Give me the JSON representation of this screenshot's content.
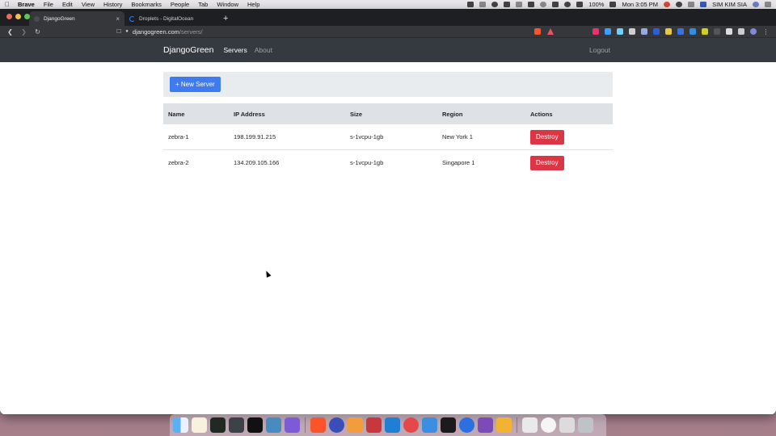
{
  "menubar": {
    "app": "Brave",
    "menus": [
      "File",
      "Edit",
      "View",
      "History",
      "Bookmarks",
      "People",
      "Tab",
      "Window",
      "Help"
    ],
    "battery": "100%",
    "clock": "Mon 3:05 PM",
    "user": "SIM KIM SIA"
  },
  "browser": {
    "tabs": [
      {
        "title": "DjangoGreen",
        "icon": "page-icon"
      },
      {
        "title": "Droplets - DigitalOcean",
        "icon": "digitalocean-icon"
      }
    ],
    "url_host": "djangogreen.com",
    "url_path": "/servers/"
  },
  "navbar": {
    "brand": "DjangoGreen",
    "links": [
      "Servers",
      "About"
    ],
    "logout": "Logout"
  },
  "toolbar": {
    "new_server_label": "+ New Server"
  },
  "table": {
    "headers": [
      "Name",
      "IP Address",
      "Size",
      "Region",
      "Actions"
    ],
    "rows": [
      {
        "name": "zebra-1",
        "ip": "198.199.91.215",
        "size": "s-1vcpu-1gb",
        "region": "New York 1",
        "action": "Destroy"
      },
      {
        "name": "zebra-2",
        "ip": "134.209.105.166",
        "size": "s-1vcpu-1gb",
        "region": "Singapore 1",
        "action": "Destroy"
      }
    ]
  },
  "colors": {
    "navbar_bg": "#343a40",
    "primary": "#3f7bf0",
    "danger": "#dc3545",
    "jumbotron_bg": "#e9ecef"
  },
  "dock": {
    "icons": [
      "finder-icon",
      "notes-icon",
      "activity-monitor-icon",
      "layers-icon",
      "apple-tv-icon",
      "godot-icon",
      "obsidian-icon",
      "brave-icon",
      "github-desktop-icon",
      "sublime-icon",
      "zotero-icon",
      "vscode-icon",
      "pocketcasts-icon",
      "simulator-icon",
      "terminal-icon",
      "onepassword-icon",
      "mongodb-compass-icon",
      "pouch-icon",
      "folder-icon",
      "onepassword-mini-icon",
      "keyboard-icon",
      "trash-icon"
    ]
  }
}
